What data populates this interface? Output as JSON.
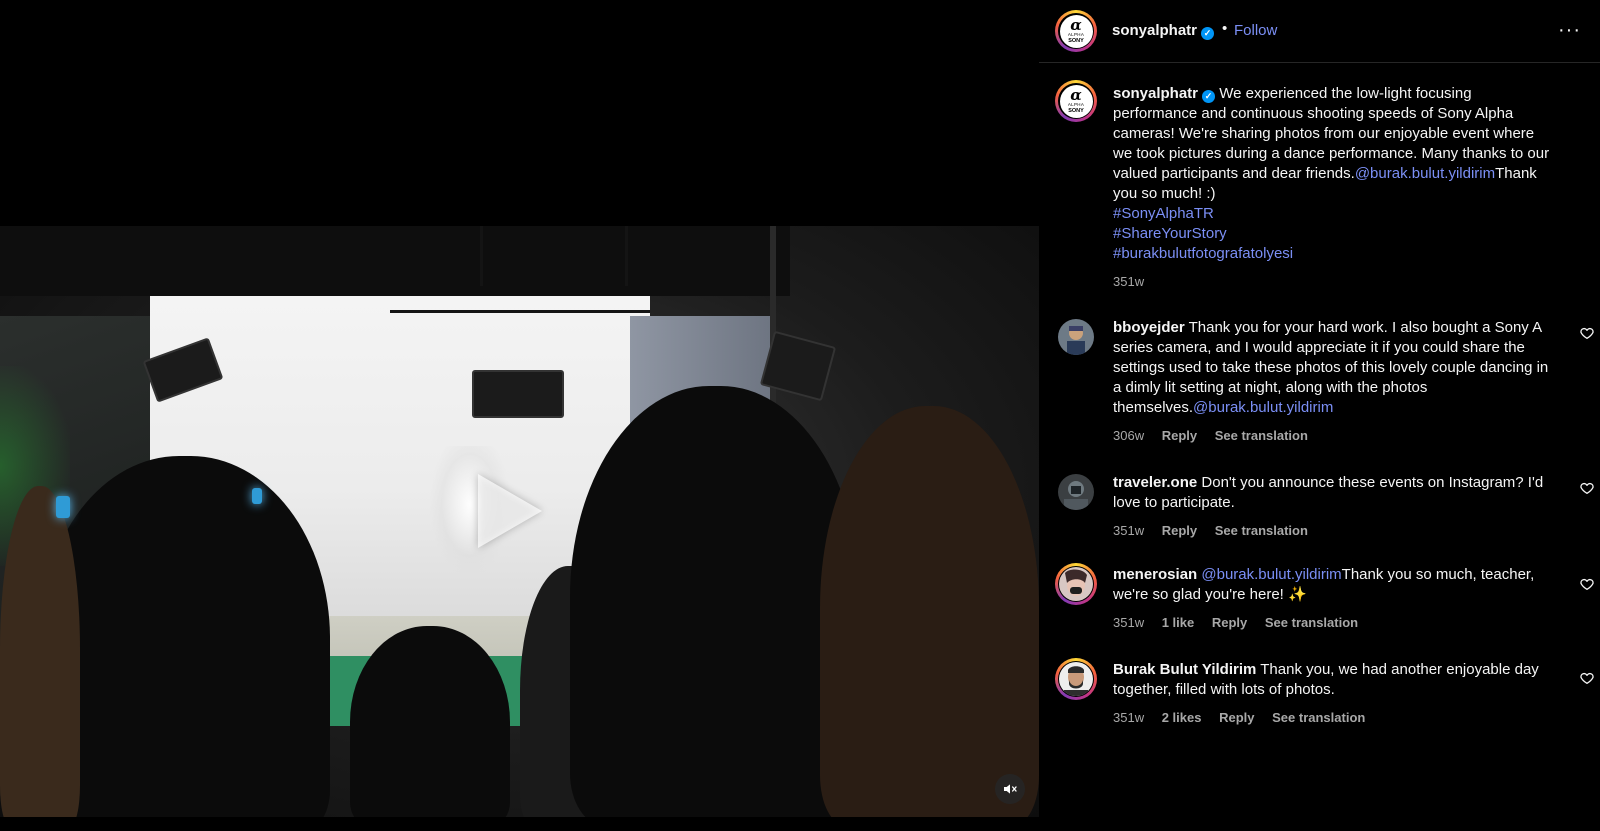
{
  "post": {
    "username": "sonyalphatr",
    "follow_label": "Follow",
    "separator": "•",
    "more_label": "···",
    "logo": {
      "mark": "α",
      "small": "ALPHA",
      "brand": "SONY"
    }
  },
  "media": {
    "type": "video",
    "play_icon": "play-icon",
    "mute_icon": "speaker-muted-icon"
  },
  "caption": {
    "username": "sonyalphatr",
    "text": "We experienced the low-light focusing performance and continuous shooting speeds of Sony Alpha cameras! We're sharing photos from our enjoyable event where we took pictures during a dance performance. Many thanks to our valued participants and dear friends.",
    "mention": "@burak.bulut.yildirim",
    "text_after": "Thank you so much! :)",
    "hashtags": [
      "#SonyAlphaTR",
      "#ShareYourStory",
      "#burakbulutfotografatolyesi"
    ],
    "time": "351w"
  },
  "comments": [
    {
      "username": "bboyejder",
      "text": "Thank you for your hard work. I also bought a Sony A series camera, and I would appreciate it if you could share the settings used to take these photos of this lovely couple dancing in a dimly lit setting at night, along with the photos themselves.",
      "mention": "@burak.bulut.yildirim",
      "time": "306w",
      "reply": "Reply",
      "translate": "See translation"
    },
    {
      "username": "traveler.one",
      "text": "Don't you announce these events on Instagram? I'd love to participate.",
      "time": "351w",
      "reply": "Reply",
      "translate": "See translation"
    },
    {
      "username": "menerosian",
      "mention": "@burak.bulut.yildirim",
      "text": "Thank you so much, teacher, we're so glad you're here! ✨",
      "time": "351w",
      "likes": "1 like",
      "reply": "Reply",
      "translate": "See translation"
    },
    {
      "username": "Burak Bulut Yildirim",
      "text": "Thank you, we had another enjoyable day together, filled with lots of photos.",
      "time": "351w",
      "likes": "2 likes",
      "reply": "Reply",
      "translate": "See translation"
    }
  ],
  "colors": {
    "link": "#7b8ff5",
    "verified": "#0095f6",
    "muted_text": "#a8a8a8"
  }
}
